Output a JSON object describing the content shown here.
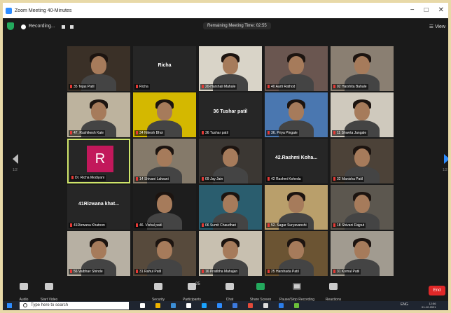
{
  "window": {
    "title": "Zoom Meeting 40-Minutes",
    "controls": [
      "−",
      "□",
      "✕"
    ]
  },
  "meeting_bar": {
    "recording_label": "Recording...",
    "timer": "Remaining Meeting Time: 02:55",
    "view_label": "View"
  },
  "pagination": {
    "left": "1/2",
    "right": "1/2"
  },
  "participants": [
    {
      "label": "35 Tejas Patil",
      "type": "video",
      "color": "#3a3027"
    },
    {
      "label": "Richa",
      "type": "name",
      "name_display": "Richa"
    },
    {
      "label": "20-Harshali Mahale",
      "type": "video",
      "color": "#d9d4c8"
    },
    {
      "label": "40 Aarti Rathod",
      "type": "video",
      "color": "#6a5650"
    },
    {
      "label": "02 Harshita Bahale",
      "type": "video",
      "color": "#8a7f72"
    },
    {
      "label": "47, Rushikesh Kale",
      "type": "video",
      "color": "#bdb39e"
    },
    {
      "label": "34 Nikesh Bhoi",
      "type": "video",
      "color": "#d4b800"
    },
    {
      "label": "36 Tushar patil",
      "type": "name",
      "name_display": "36 Tushar patil"
    },
    {
      "label": "36. Priya Pingale",
      "type": "video",
      "color": "#4a77b0"
    },
    {
      "label": "11 Shweta Jangale",
      "type": "video",
      "color": "#cfc9bd"
    },
    {
      "label": "Dr. Richa Modiyani",
      "type": "avatar",
      "avatar_letter": "R",
      "active": true
    },
    {
      "label": "14 Shivani Lalwani",
      "type": "video",
      "color": "#857a6a"
    },
    {
      "label": "09 Jay Jain",
      "type": "video",
      "color": "#3b3733"
    },
    {
      "label": "42 Rashmi Koheda",
      "type": "name",
      "name_display": "42.Rashmi Koha..."
    },
    {
      "label": "32 Manisha Patil",
      "type": "video",
      "color": "#4c4238"
    },
    {
      "label": "41Rizwana Khatoon",
      "type": "name",
      "name_display": "41Rizwana khat..."
    },
    {
      "label": "46. Vishal patil",
      "type": "video",
      "color": "#1d1d1d"
    },
    {
      "label": "06 Sumit Chaudhari",
      "type": "video",
      "color": "#2a5d6e"
    },
    {
      "label": "52. Sagar Suryavanshi",
      "type": "video",
      "color": "#b99f6b"
    },
    {
      "label": "18 Shivani Rajput",
      "type": "video",
      "color": "#5c574f"
    },
    {
      "label": "56 Vaibhav Shinde",
      "type": "video",
      "color": "#b7b0a3"
    },
    {
      "label": "31 Rahul Patil",
      "type": "video",
      "color": "#574a3c"
    },
    {
      "label": "16 Pratibha Mahajan",
      "type": "video",
      "color": "#c8c0b0"
    },
    {
      "label": "25 Harshada Patil",
      "type": "video",
      "color": "#6b5433"
    },
    {
      "label": "31 Komal Patil",
      "type": "video",
      "color": "#a19b90"
    }
  ],
  "toolbar": {
    "audio": "Audio",
    "video": "Start Video",
    "security": "Security",
    "participants": "Participants",
    "participants_count": "25",
    "chat": "Chat",
    "share": "Share Screen",
    "record": "Pause/Stop Recording",
    "reactions": "Reactions",
    "end": "End"
  },
  "taskbar": {
    "search_placeholder": "Type here to search",
    "language": "ENG",
    "time": "12:56",
    "date": "01-12-2021"
  },
  "colors": {
    "accent": "#2d8cff",
    "active_speaker": "#cfe56a",
    "end_button": "#e02828",
    "avatar_bg": "#c2185b"
  }
}
